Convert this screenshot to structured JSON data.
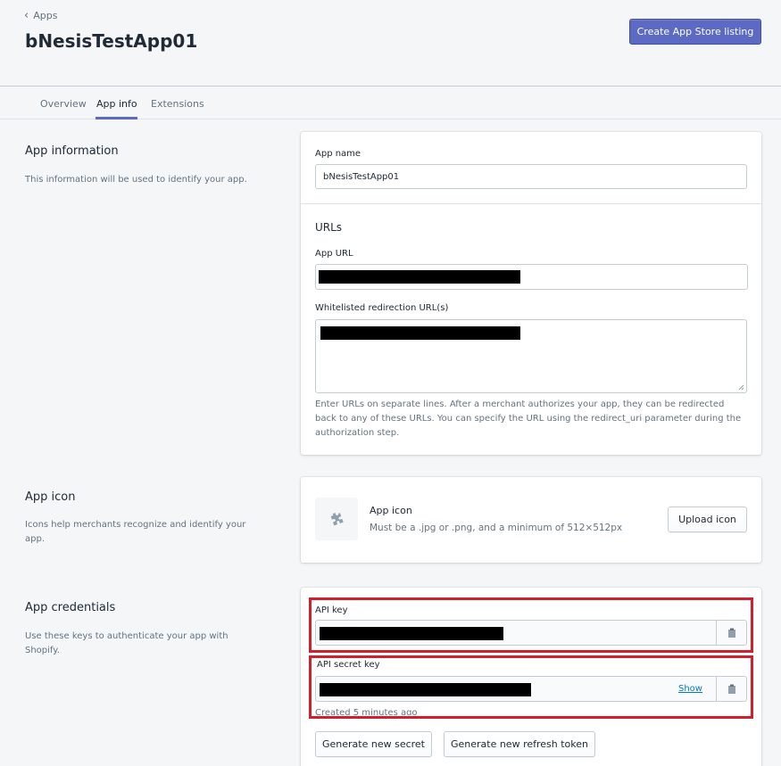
{
  "header": {
    "back_label": "Apps",
    "title": "bNesisTestApp01",
    "create_listing_label": "Create App Store listing"
  },
  "tabs": [
    {
      "label": "Overview",
      "active": false
    },
    {
      "label": "App info",
      "active": true
    },
    {
      "label": "Extensions",
      "active": false
    }
  ],
  "app_information": {
    "title": "App information",
    "description": "This information will be used to identify your app.",
    "app_name_label": "App name",
    "app_name_value": "bNesisTestApp01",
    "urls_heading": "URLs",
    "app_url_label": "App URL",
    "redirect_label": "Whitelisted redirection URL(s)",
    "redirect_help": "Enter URLs on separate lines. After a merchant authorizes your app, they can be redirected back to any of these URLs. You can specify the URL using the redirect_uri parameter during the authorization step."
  },
  "app_icon": {
    "title": "App icon",
    "description": "Icons help merchants recognize and identify your app.",
    "label": "App icon",
    "hint": "Must be a .jpg or .png, and a minimum of 512×512px",
    "upload_label": "Upload icon"
  },
  "app_credentials": {
    "title": "App credentials",
    "description": "Use these keys to authenticate your app with Shopify.",
    "api_key_label": "API key",
    "api_secret_label": "API secret key",
    "show_label": "Show",
    "created_text": "Created 5 minutes ago",
    "generate_secret_label": "Generate new secret",
    "generate_refresh_label": "Generate new refresh token"
  },
  "colors": {
    "primary": "#5c6ac4",
    "highlight": "#d0202e",
    "link": "#007ace"
  }
}
